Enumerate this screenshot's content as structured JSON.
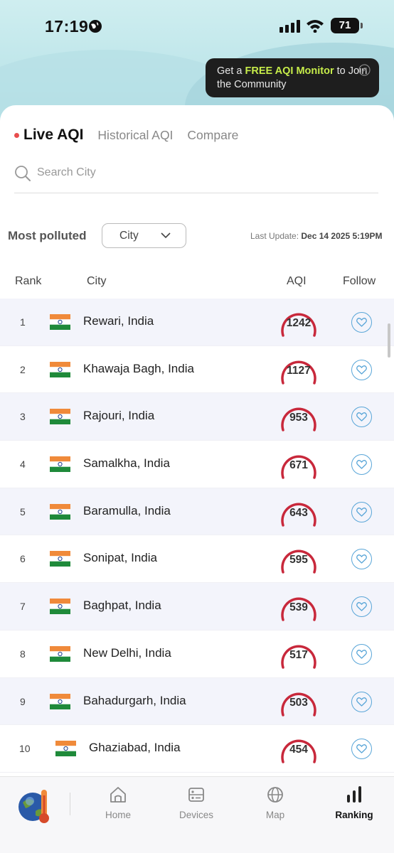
{
  "status_bar": {
    "time": "17:19",
    "battery": "71"
  },
  "promo": {
    "prefix": "Get a ",
    "highlight": "FREE AQI Monitor",
    "suffix": " to Join the Community"
  },
  "tabs": [
    "Live AQI",
    "Historical AQI",
    "Compare"
  ],
  "search": {
    "placeholder": "Search City",
    "value": ""
  },
  "filter": {
    "label": "Most polluted",
    "selected": "City",
    "last_update_label": "Last Update:",
    "last_update_value": "Dec 14 2025 5:19PM"
  },
  "table": {
    "headers": {
      "rank": "Rank",
      "city": "City",
      "aqi": "AQI",
      "follow": "Follow"
    },
    "rows": [
      {
        "rank": "1",
        "city": "Rewari, India",
        "aqi": "1242"
      },
      {
        "rank": "2",
        "city": "Khawaja Bagh, India",
        "aqi": "1127"
      },
      {
        "rank": "3",
        "city": "Rajouri, India",
        "aqi": "953"
      },
      {
        "rank": "4",
        "city": "Samalkha, India",
        "aqi": "671"
      },
      {
        "rank": "5",
        "city": "Baramulla, India",
        "aqi": "643"
      },
      {
        "rank": "6",
        "city": "Sonipat, India",
        "aqi": "595"
      },
      {
        "rank": "7",
        "city": "Baghpat, India",
        "aqi": "539"
      },
      {
        "rank": "8",
        "city": "New Delhi, India",
        "aqi": "517"
      },
      {
        "rank": "9",
        "city": "Bahadurgarh, India",
        "aqi": "503"
      },
      {
        "rank": "10",
        "city": "Ghaziabad, India",
        "aqi": "454"
      }
    ]
  },
  "bottom_nav": {
    "items": [
      {
        "label": "Home",
        "icon": "home-icon"
      },
      {
        "label": "Devices",
        "icon": "device-icon"
      },
      {
        "label": "Map",
        "icon": "globe-icon"
      },
      {
        "label": "Ranking",
        "icon": "bar-chart-icon"
      }
    ],
    "active": "Ranking"
  },
  "colors": {
    "gauge": "#c8283b",
    "accent_dot": "#e84e4e",
    "promo_highlight": "#c6ec4a",
    "follow": "#5aa6d8"
  }
}
